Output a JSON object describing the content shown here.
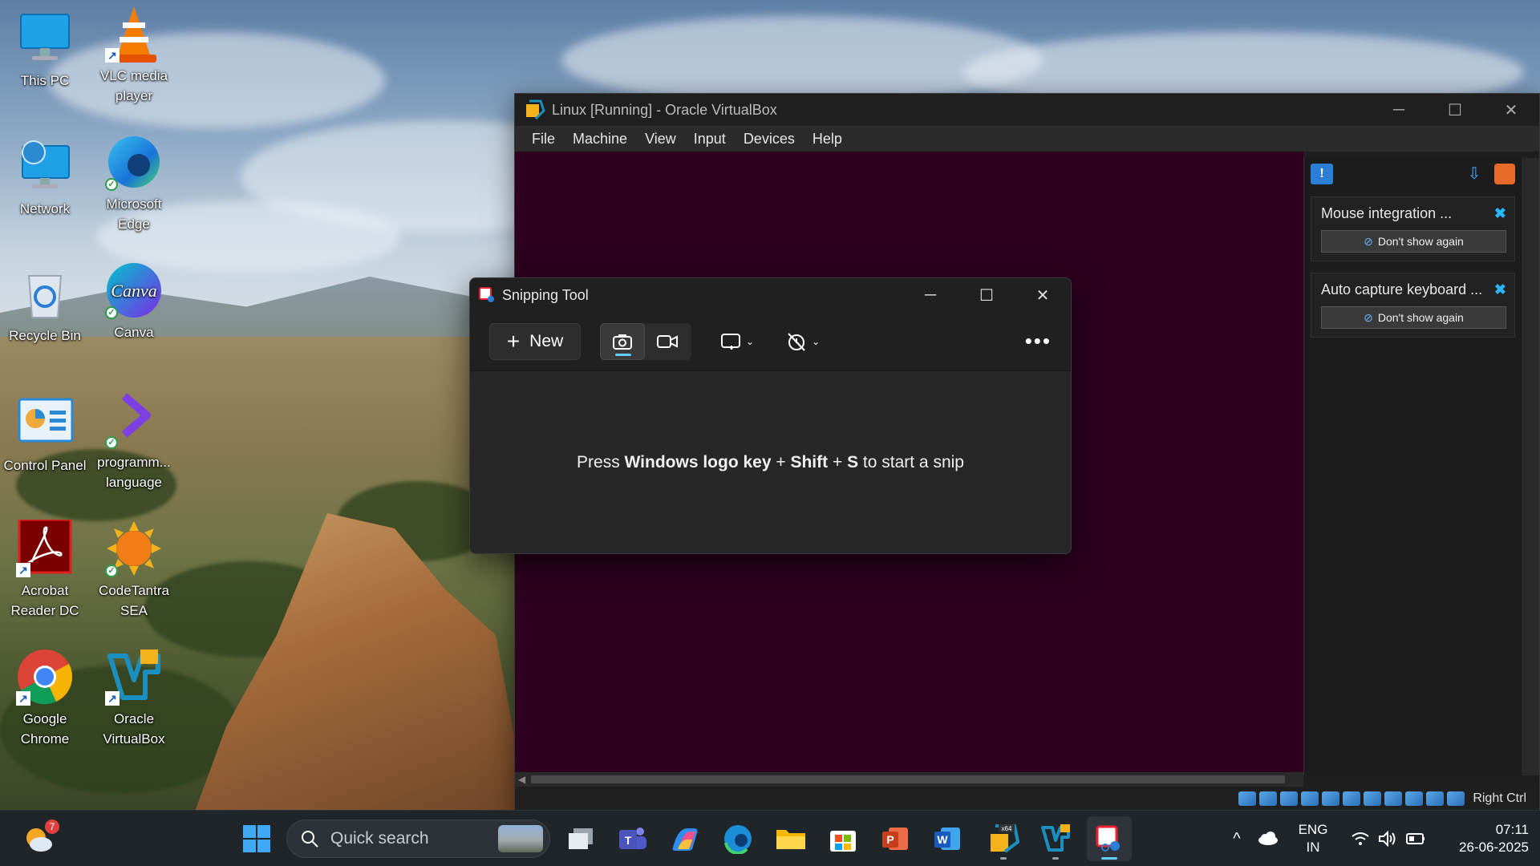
{
  "desktop": {
    "icons": [
      {
        "label": "This PC",
        "icon": "this-pc-icon"
      },
      {
        "label": "VLC media player",
        "icon": "vlc-icon"
      },
      {
        "label": "Network",
        "icon": "network-icon"
      },
      {
        "label": "Microsoft Edge",
        "icon": "edge-icon"
      },
      {
        "label": "Recycle Bin",
        "icon": "recycle-bin-icon"
      },
      {
        "label": "Canva",
        "icon": "canva-icon"
      },
      {
        "label": "Control Panel",
        "icon": "control-panel-icon"
      },
      {
        "label": "programm... language",
        "icon": "programming-language-icon"
      },
      {
        "label": "Acrobat Reader DC",
        "icon": "acrobat-icon"
      },
      {
        "label": "CodeTantra SEA",
        "icon": "codetantra-icon"
      },
      {
        "label": "Google Chrome",
        "icon": "chrome-icon"
      },
      {
        "label": "Oracle VirtualBox",
        "icon": "virtualbox-icon"
      }
    ],
    "canva_logo_text": "Canva"
  },
  "vbox": {
    "title": "Linux [Running] - Oracle VirtualBox",
    "menu": [
      "File",
      "Machine",
      "View",
      "Input",
      "Devices",
      "Help"
    ],
    "notifications": [
      {
        "text": "Mouse integration ...",
        "button": "Don't show again"
      },
      {
        "text": "Auto capture keyboard ...",
        "button": "Don't show again"
      }
    ],
    "host_key": "Right Ctrl",
    "guest_bg": "#2c001e"
  },
  "snip": {
    "title": "Snipping Tool",
    "new_label": "New",
    "hint_prefix": "Press ",
    "hint_key1": "Windows logo key",
    "hint_plus1": " + ",
    "hint_key2": "Shift",
    "hint_plus2": " + ",
    "hint_key3": "S",
    "hint_suffix": " to start a snip",
    "accent": "#60cdff"
  },
  "taskbar": {
    "weather_badge": "7",
    "search_placeholder": "Quick search",
    "lang_line1": "ENG",
    "lang_line2": "IN",
    "time": "07:11",
    "date": "26-06-2025",
    "x64_badge": "x64"
  }
}
